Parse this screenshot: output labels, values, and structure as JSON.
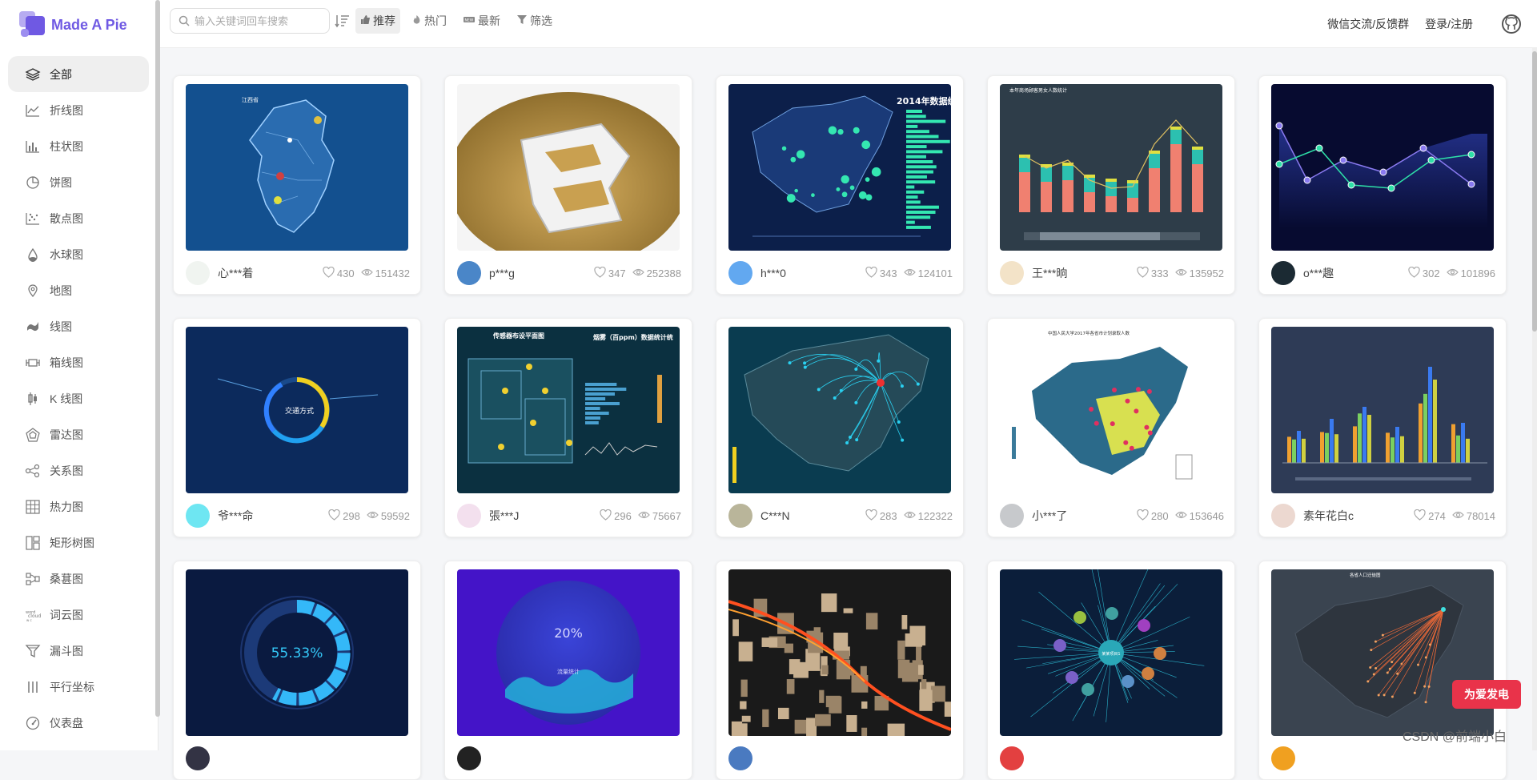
{
  "app": {
    "name": "Made A Pie"
  },
  "search": {
    "placeholder": "输入关键词回车搜索"
  },
  "filters": [
    {
      "label": "推荐",
      "icon": "thumb-up-icon",
      "active": true
    },
    {
      "label": "热门",
      "icon": "flame-icon",
      "active": false
    },
    {
      "label": "最新",
      "icon": "new-badge-icon",
      "active": false
    },
    {
      "label": "筛选",
      "icon": "filter-icon",
      "active": false
    }
  ],
  "header": {
    "feedback": "微信交流/反馈群",
    "login": "登录/注册"
  },
  "sidebar": {
    "items": [
      {
        "label": "全部",
        "icon": "layers-icon"
      },
      {
        "label": "折线图",
        "icon": "line-chart-icon"
      },
      {
        "label": "柱状图",
        "icon": "bar-chart-icon"
      },
      {
        "label": "饼图",
        "icon": "pie-chart-icon"
      },
      {
        "label": "散点图",
        "icon": "scatter-chart-icon"
      },
      {
        "label": "水球图",
        "icon": "liquid-drop-icon"
      },
      {
        "label": "地图",
        "icon": "map-pin-icon"
      },
      {
        "label": "线图",
        "icon": "lines-icon"
      },
      {
        "label": "箱线图",
        "icon": "boxplot-icon"
      },
      {
        "label": "K 线图",
        "icon": "candlestick-icon"
      },
      {
        "label": "雷达图",
        "icon": "radar-icon"
      },
      {
        "label": "关系图",
        "icon": "graph-icon"
      },
      {
        "label": "热力图",
        "icon": "heatmap-icon"
      },
      {
        "label": "矩形树图",
        "icon": "treemap-icon"
      },
      {
        "label": "桑葚图",
        "icon": "sankey-icon"
      },
      {
        "label": "词云图",
        "icon": "wordcloud-icon"
      },
      {
        "label": "漏斗图",
        "icon": "funnel-icon"
      },
      {
        "label": "平行坐标",
        "icon": "parallel-icon"
      },
      {
        "label": "仪表盘",
        "icon": "gauge-icon"
      }
    ]
  },
  "cards": [
    {
      "user": "心***着",
      "likes": "430",
      "views": "151432",
      "thumb": "jiangxi-map",
      "avatar_color": "#f0f4f0"
    },
    {
      "user": "p***g",
      "likes": "347",
      "views": "252388",
      "thumb": "bitcoin-3d",
      "avatar_color": "#4a86c8"
    },
    {
      "user": "h***0",
      "likes": "343",
      "views": "124101",
      "thumb": "china-map-2014",
      "avatar_color": "#62a8f0"
    },
    {
      "user": "王***晌",
      "likes": "333",
      "views": "135952",
      "thumb": "bar-line-combo",
      "avatar_color": "#f3e3c8"
    },
    {
      "user": "o***趣",
      "likes": "302",
      "views": "101896",
      "thumb": "area-line-dark",
      "avatar_color": "#1b2a33"
    },
    {
      "user": "爷***命",
      "likes": "298",
      "views": "59592",
      "thumb": "ring-traffic",
      "avatar_color": "#6ee6f2"
    },
    {
      "user": "張***J",
      "likes": "296",
      "views": "75667",
      "thumb": "sensor-dashboard",
      "avatar_color": "#f3e0ee"
    },
    {
      "user": "C***N",
      "likes": "283",
      "views": "122322",
      "thumb": "china-flow",
      "avatar_color": "#b9b59a"
    },
    {
      "user": "小***了",
      "likes": "280",
      "views": "153646",
      "thumb": "china-choropleth",
      "avatar_color": "#c7c9cc"
    },
    {
      "user": "素年花白c",
      "likes": "274",
      "views": "78014",
      "thumb": "multi-bar",
      "avatar_color": "#ecd8d0"
    },
    {
      "user": "",
      "likes": "",
      "views": "",
      "thumb": "gauge-percent",
      "gauge_text": "55.33%",
      "avatar_color": "#334"
    },
    {
      "user": "",
      "likes": "",
      "views": "",
      "thumb": "liquid-20",
      "gauge_text": "20%",
      "avatar_color": "#222"
    },
    {
      "user": "",
      "likes": "",
      "views": "",
      "thumb": "city-3d",
      "avatar_color": "#4a7ac0"
    },
    {
      "user": "",
      "likes": "",
      "views": "",
      "thumb": "tree-graph",
      "avatar_color": "#e34040"
    },
    {
      "user": "",
      "likes": "",
      "views": "",
      "thumb": "china-migration",
      "avatar_color": "#f0a020"
    }
  ],
  "thumb_text": {
    "map2014": "2014年数据统",
    "sensor_title": "传感器布设平面图",
    "sensor_title2": "烟雾（百ppm）数据统计统",
    "traffic": "交通方式",
    "liquid_sub": "流量统计",
    "tree_center": "某某项目1",
    "migration_title": "各省人口迁徙图",
    "choropleth_title": "中国人民大学2017年各省市计划录取人数",
    "barline_title": "本年商场顾客男女人数统计"
  },
  "donate": "为爱发电",
  "watermark": "CSDN @前端小白⁠"
}
